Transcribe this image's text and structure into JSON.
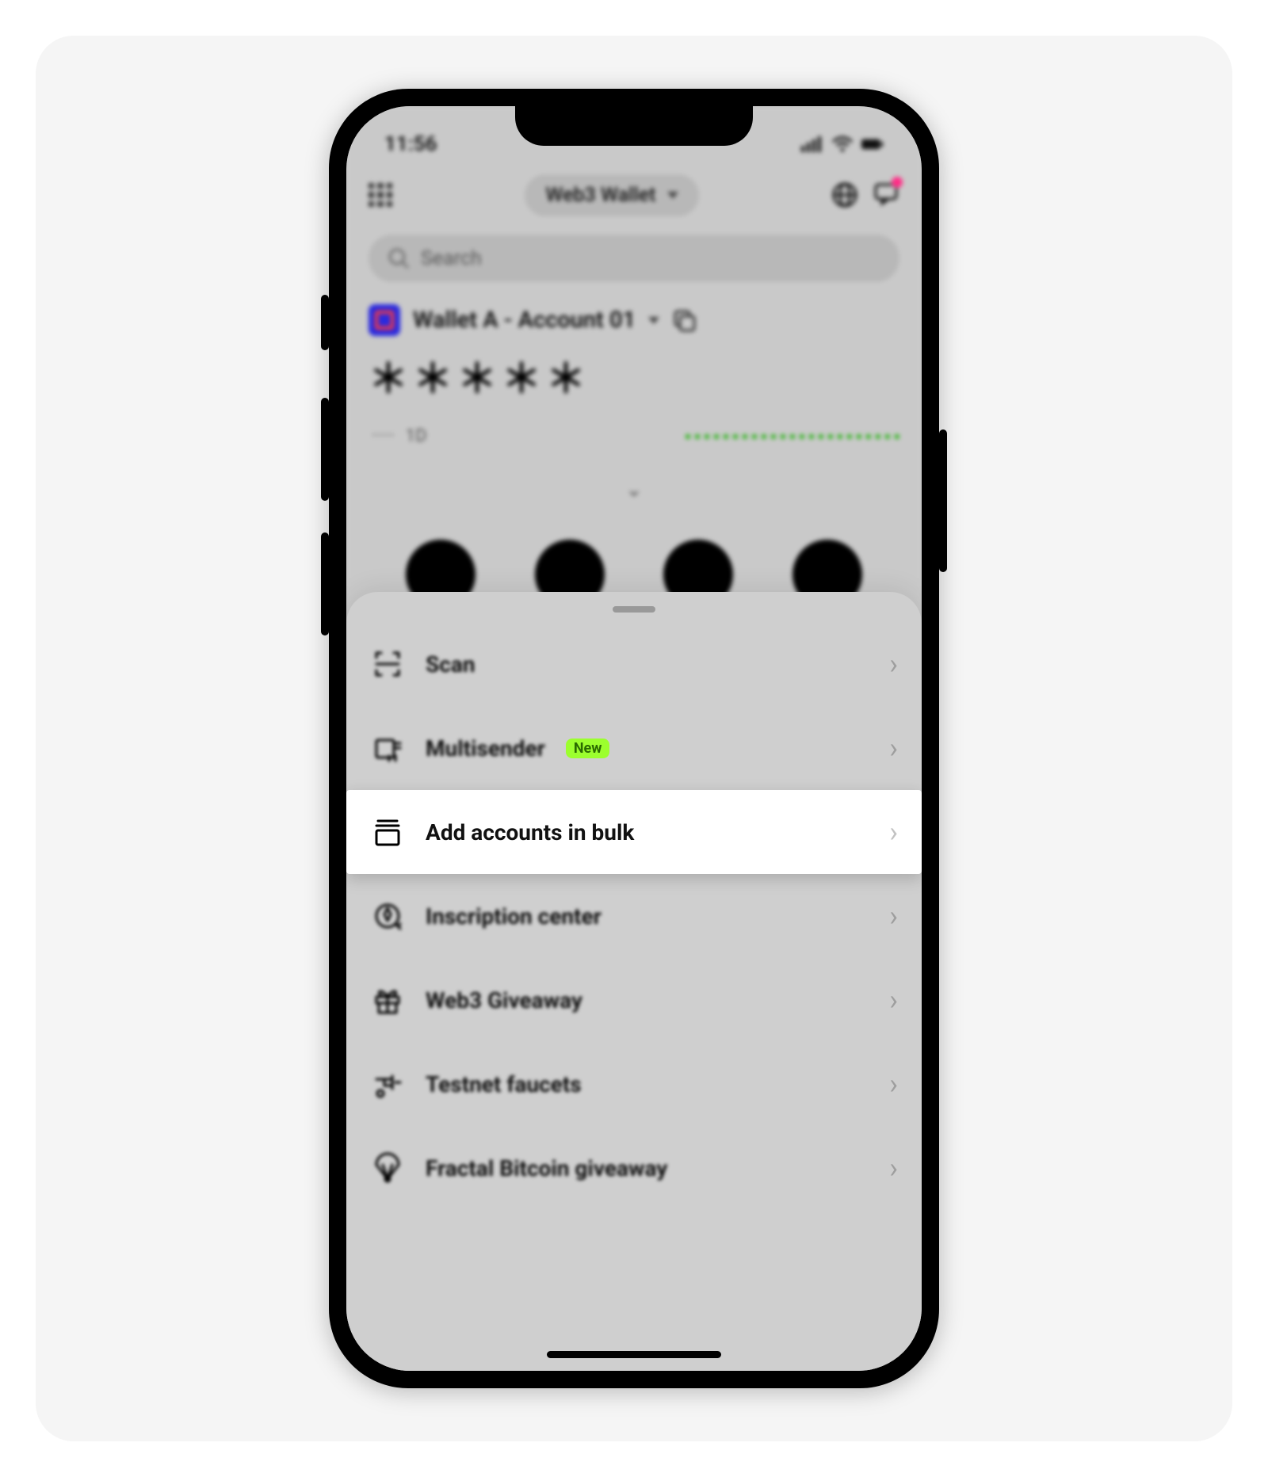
{
  "status": {
    "time": "11:56"
  },
  "header": {
    "title": "Web3 Wallet",
    "search_placeholder": "Search"
  },
  "account": {
    "label": "Wallet A - Account 01",
    "balance_masked": "＊＊＊＊＊",
    "hidden_stats": "·····",
    "timeframe": "1D"
  },
  "sheet": {
    "items": [
      {
        "id": "scan",
        "label": "Scan",
        "icon": "scan-icon",
        "badge": null,
        "highlight": false
      },
      {
        "id": "multisender",
        "label": "Multisender",
        "icon": "multisender-icon",
        "badge": "New",
        "highlight": false
      },
      {
        "id": "add-bulk",
        "label": "Add accounts in bulk",
        "icon": "bulk-icon",
        "badge": null,
        "highlight": true
      },
      {
        "id": "inscription",
        "label": "Inscription center",
        "icon": "inscription-icon",
        "badge": null,
        "highlight": false
      },
      {
        "id": "giveaway",
        "label": "Web3 Giveaway",
        "icon": "gift-icon",
        "badge": null,
        "highlight": false
      },
      {
        "id": "faucets",
        "label": "Testnet faucets",
        "icon": "faucet-icon",
        "badge": null,
        "highlight": false
      },
      {
        "id": "fractal",
        "label": "Fractal Bitcoin giveaway",
        "icon": "parachute-icon",
        "badge": null,
        "highlight": false
      }
    ]
  }
}
